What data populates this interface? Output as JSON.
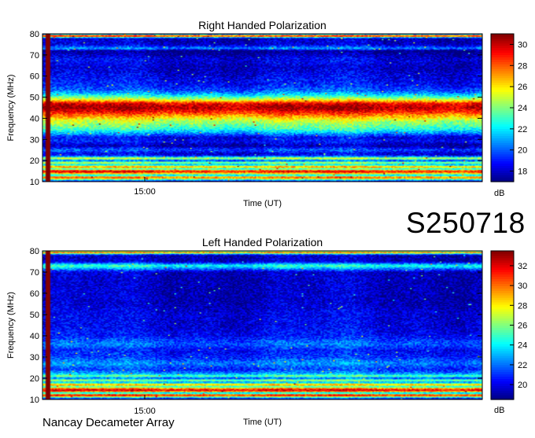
{
  "observation_id": "S250718",
  "instrument_label": "Nancay Decameter Array",
  "chart_data": [
    {
      "type": "heatmap",
      "title": "Right Handed Polarization",
      "xlabel": "Time (UT)",
      "ylabel": "Frequency (MHz)",
      "xticks": [
        "15:00"
      ],
      "ylim": [
        10,
        80
      ],
      "yticks": [
        10,
        20,
        30,
        40,
        50,
        60,
        70,
        80
      ],
      "colorbar": {
        "label": "dB",
        "range": [
          17,
          31
        ],
        "ticks": [
          18,
          20,
          22,
          24,
          26,
          28,
          30
        ]
      },
      "profile": [
        {
          "f": 10,
          "v": 17.5
        },
        {
          "f": 11,
          "v": 23
        },
        {
          "f": 12,
          "v": 29
        },
        {
          "f": 13,
          "v": 21
        },
        {
          "f": 14,
          "v": 27
        },
        {
          "f": 15,
          "v": 30
        },
        {
          "f": 16,
          "v": 22
        },
        {
          "f": 17,
          "v": 28
        },
        {
          "f": 18,
          "v": 21
        },
        {
          "f": 19,
          "v": 25
        },
        {
          "f": 20,
          "v": 19
        },
        {
          "f": 21,
          "v": 26
        },
        {
          "f": 22,
          "v": 20
        },
        {
          "f": 23,
          "v": 18
        },
        {
          "f": 25,
          "v": 20
        },
        {
          "f": 27,
          "v": 17.5
        },
        {
          "f": 29,
          "v": 19
        },
        {
          "f": 31,
          "v": 18.5
        },
        {
          "f": 33,
          "v": 21
        },
        {
          "f": 35,
          "v": 23
        },
        {
          "f": 37,
          "v": 24
        },
        {
          "f": 39,
          "v": 25
        },
        {
          "f": 41,
          "v": 27
        },
        {
          "f": 43,
          "v": 29
        },
        {
          "f": 45,
          "v": 30.5
        },
        {
          "f": 47,
          "v": 29.5
        },
        {
          "f": 49,
          "v": 25
        },
        {
          "f": 51,
          "v": 22
        },
        {
          "f": 53,
          "v": 20
        },
        {
          "f": 56,
          "v": 19
        },
        {
          "f": 60,
          "v": 18.5
        },
        {
          "f": 64,
          "v": 18
        },
        {
          "f": 68,
          "v": 18.5
        },
        {
          "f": 72,
          "v": 17
        },
        {
          "f": 73,
          "v": 21
        },
        {
          "f": 75,
          "v": 18
        },
        {
          "f": 78,
          "v": 18
        },
        {
          "f": 79,
          "v": 31
        },
        {
          "f": 80,
          "v": 18
        }
      ]
    },
    {
      "type": "heatmap",
      "title": "Left Handed Polarization",
      "xlabel": "Time (UT)",
      "ylabel": "Frequency (MHz)",
      "xticks": [
        "15:00"
      ],
      "ylim": [
        10,
        80
      ],
      "yticks": [
        10,
        20,
        30,
        40,
        50,
        60,
        70,
        80
      ],
      "colorbar": {
        "label": "dB",
        "range": [
          18.5,
          33.5
        ],
        "ticks": [
          20,
          22,
          24,
          26,
          28,
          30,
          32
        ]
      },
      "profile": [
        {
          "f": 10,
          "v": 19
        },
        {
          "f": 11,
          "v": 24
        },
        {
          "f": 12,
          "v": 33
        },
        {
          "f": 13,
          "v": 22
        },
        {
          "f": 14,
          "v": 32
        },
        {
          "f": 15,
          "v": 31
        },
        {
          "f": 16,
          "v": 24
        },
        {
          "f": 17,
          "v": 30
        },
        {
          "f": 18,
          "v": 22
        },
        {
          "f": 19,
          "v": 27
        },
        {
          "f": 20,
          "v": 21
        },
        {
          "f": 21,
          "v": 26
        },
        {
          "f": 22,
          "v": 23
        },
        {
          "f": 24,
          "v": 21
        },
        {
          "f": 27,
          "v": 22.5
        },
        {
          "f": 30,
          "v": 21
        },
        {
          "f": 33,
          "v": 20.5
        },
        {
          "f": 36,
          "v": 22
        },
        {
          "f": 40,
          "v": 20.5
        },
        {
          "f": 45,
          "v": 20
        },
        {
          "f": 50,
          "v": 20
        },
        {
          "f": 55,
          "v": 19.5
        },
        {
          "f": 60,
          "v": 19.5
        },
        {
          "f": 65,
          "v": 19.5
        },
        {
          "f": 70,
          "v": 19.5
        },
        {
          "f": 73,
          "v": 25
        },
        {
          "f": 75,
          "v": 19.5
        },
        {
          "f": 78,
          "v": 19.5
        },
        {
          "f": 79.5,
          "v": 32
        },
        {
          "f": 80,
          "v": 20
        }
      ]
    }
  ]
}
